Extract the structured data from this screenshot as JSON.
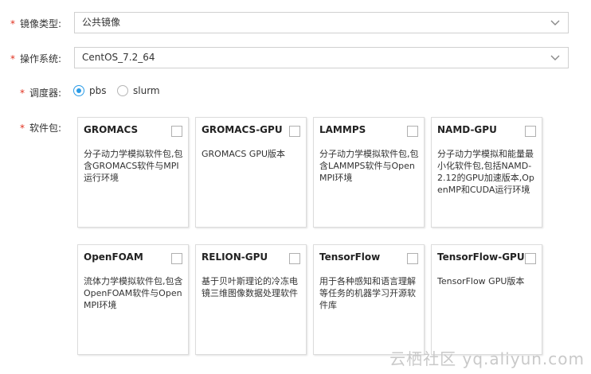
{
  "form": {
    "image_type": {
      "label": "镜像类型:",
      "value": "公共镜像"
    },
    "os": {
      "label": "操作系统:",
      "value": "CentOS_7.2_64"
    },
    "scheduler": {
      "label": "调度器:",
      "options": [
        {
          "label": "pbs",
          "checked": true
        },
        {
          "label": "slurm",
          "checked": false
        }
      ]
    },
    "software": {
      "label": "软件包:",
      "packages": [
        {
          "title": "GROMACS",
          "desc": "分子动力学模拟软件包,包含GROMACS软件与MPI运行环境",
          "checked": false
        },
        {
          "title": "GROMACS-GPU",
          "desc": "GROMACS GPU版本",
          "checked": false
        },
        {
          "title": "LAMMPS",
          "desc": "分子动力学模拟软件包,包含LAMMPS软件与OpenMPI环境",
          "checked": false
        },
        {
          "title": "NAMD-GPU",
          "desc": "分子动力学模拟和能量最小化软件包,包括NAMD-2.12的GPU加速版本,OpenMP和CUDA运行环境",
          "checked": false
        },
        {
          "title": "OpenFOAM",
          "desc": "流体力学模拟软件包,包含OpenFOAM软件与OpenMPI环境",
          "checked": false
        },
        {
          "title": "RELION-GPU",
          "desc": "基于贝叶斯理论的冷冻电镜三维图像数据处理软件",
          "checked": false
        },
        {
          "title": "TensorFlow",
          "desc": "用于各种感知和语言理解等任务的机器学习开源软件库",
          "checked": false
        },
        {
          "title": "TensorFlow-GPU",
          "desc": "TensorFlow GPU版本",
          "checked": false
        }
      ]
    }
  },
  "required_mark": "*",
  "watermark": "云栖社区 yq.aliyun.com",
  "colors": {
    "required": "#e0301e",
    "radio_accent": "#2a9be6",
    "border": "#d0d0d0"
  }
}
